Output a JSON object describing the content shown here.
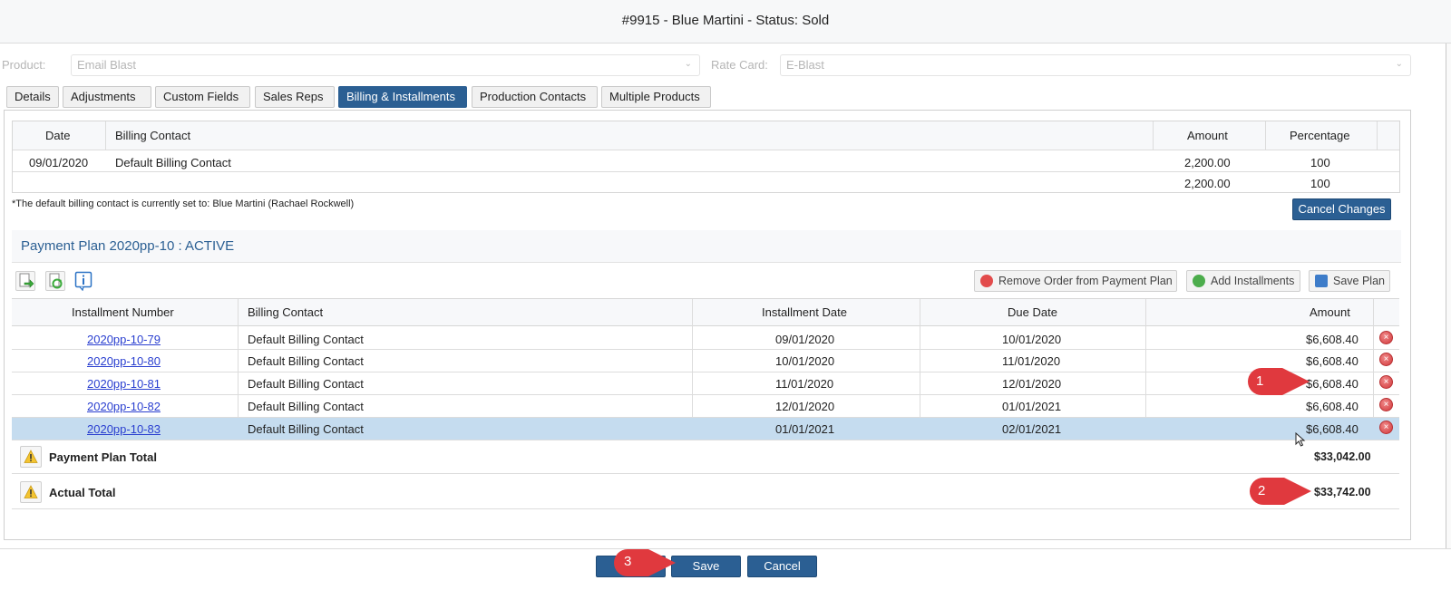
{
  "window": {
    "title": "#9915 - Blue Martini - Status: Sold"
  },
  "form": {
    "product_label": "Product:",
    "product_value": "Email Blast",
    "rate_card_label": "Rate Card:",
    "rate_card_value": "E-Blast"
  },
  "tabs": [
    {
      "label": "Details"
    },
    {
      "label": "Adjustments"
    },
    {
      "label": "Custom Fields"
    },
    {
      "label": "Sales Reps"
    },
    {
      "label": "Billing & Installments",
      "active": true
    },
    {
      "label": "Production Contacts"
    },
    {
      "label": "Multiple Products"
    }
  ],
  "billing_table": {
    "columns": [
      "Date",
      "Billing Contact",
      "Amount",
      "Percentage"
    ],
    "rows": [
      {
        "date": "09/01/2020",
        "contact": "Default Billing Contact",
        "amount": "2,200.00",
        "percentage": "100"
      }
    ],
    "totals": {
      "amount": "2,200.00",
      "percentage": "100"
    }
  },
  "note": "*The default billing contact is currently set to: Blue Martini (Rachael Rockwell)",
  "cancel_changes_label": "Cancel Changes",
  "payment_plan": {
    "title": "Payment Plan 2020pp-10 : ACTIVE",
    "toolbar": {
      "remove_label": "Remove Order from Payment Plan",
      "add_label": "Add Installments",
      "save_label": "Save Plan"
    },
    "columns": [
      "Installment Number",
      "Billing Contact",
      "Installment Date",
      "Due Date",
      "Amount"
    ],
    "rows": [
      {
        "number": "2020pp-10-79",
        "contact": "Default Billing Contact",
        "installment_date": "09/01/2020",
        "due_date": "10/01/2020",
        "amount": "$6,608.40"
      },
      {
        "number": "2020pp-10-80",
        "contact": "Default Billing Contact",
        "installment_date": "10/01/2020",
        "due_date": "11/01/2020",
        "amount": "$6,608.40"
      },
      {
        "number": "2020pp-10-81",
        "contact": "Default Billing Contact",
        "installment_date": "11/01/2020",
        "due_date": "12/01/2020",
        "amount": "$6,608.40"
      },
      {
        "number": "2020pp-10-82",
        "contact": "Default Billing Contact",
        "installment_date": "12/01/2020",
        "due_date": "01/01/2021",
        "amount": "$6,608.40"
      },
      {
        "number": "2020pp-10-83",
        "contact": "Default Billing Contact",
        "installment_date": "01/01/2021",
        "due_date": "02/01/2021",
        "amount": "$6,608.40",
        "selected": true
      }
    ],
    "payment_plan_total_label": "Payment Plan Total",
    "payment_plan_total_value": "$33,042.00",
    "actual_total_label": "Actual Total",
    "actual_total_value": "$33,742.00"
  },
  "callouts": [
    "1",
    "2",
    "3"
  ],
  "footer": {
    "save_label": "Save",
    "cancel_label": "Cancel"
  },
  "colors": {
    "primary": "#2b5f93",
    "selected_row": "#c5dcef",
    "callout": "#e0393e",
    "link": "#2a3fd0"
  }
}
